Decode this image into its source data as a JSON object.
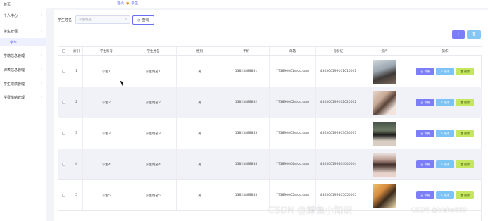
{
  "sidebar": {
    "items": [
      {
        "label": "首页",
        "arrow": ""
      },
      {
        "label": "个人中心",
        "arrow": "›"
      },
      {
        "label": "学生管理",
        "arrow": "›"
      },
      {
        "label": "学生",
        "arrow": ""
      },
      {
        "label": "学籍信息管理",
        "arrow": "›"
      },
      {
        "label": "课表信息管理",
        "arrow": "›"
      },
      {
        "label": "学生成绩管理",
        "arrow": "›"
      },
      {
        "label": "学费缴纳管理",
        "arrow": "›"
      }
    ],
    "active_index": 3
  },
  "breadcrumb": {
    "home": "首页",
    "current": "学生"
  },
  "search": {
    "label": "学生姓名",
    "placeholder": "学生姓名",
    "button": "查询"
  },
  "toolbar": {
    "add_label": "+",
    "delete_label": "🗑"
  },
  "table": {
    "headers": [
      "",
      "索引",
      "学生账号",
      "学生姓名",
      "性别",
      "手机",
      "邮箱",
      "身份证",
      "照片",
      "操作"
    ],
    "rows": [
      {
        "index": "1",
        "account": "学生1",
        "name": "学生姓名1",
        "gender": "男",
        "phone": "13823888881",
        "email": "773890001@qq.com",
        "id_card": "440300199101010001"
      },
      {
        "index": "2",
        "account": "学生2",
        "name": "学生姓名2",
        "gender": "男",
        "phone": "13823888882",
        "email": "773890002@qq.com",
        "id_card": "440300199202020002"
      },
      {
        "index": "3",
        "account": "学生3",
        "name": "学生姓名3",
        "gender": "男",
        "phone": "13823888883",
        "email": "773890003@qq.com",
        "id_card": "440300199303030003"
      },
      {
        "index": "4",
        "account": "学生4",
        "name": "学生姓名4",
        "gender": "男",
        "phone": "13823888884",
        "email": "773890004@qq.com",
        "id_card": "440300199404040004"
      },
      {
        "index": "5",
        "account": "学生5",
        "name": "学生姓名5",
        "gender": "男",
        "phone": "13823888885",
        "email": "773890005@qq.com",
        "id_card": "440300199505050005"
      }
    ],
    "actions": {
      "detail": "详情",
      "edit": "修改",
      "delete": "删除"
    }
  },
  "watermarks": {
    "center": "CSDN @鲸鱼小知识",
    "corner": "CSDN @bishe889"
  },
  "colors": {
    "accent": "#6a6ef5",
    "detail_btn": "#7b7ef7",
    "edit_btn": "#7cc4f5",
    "delete_btn": "#c5e65f"
  }
}
